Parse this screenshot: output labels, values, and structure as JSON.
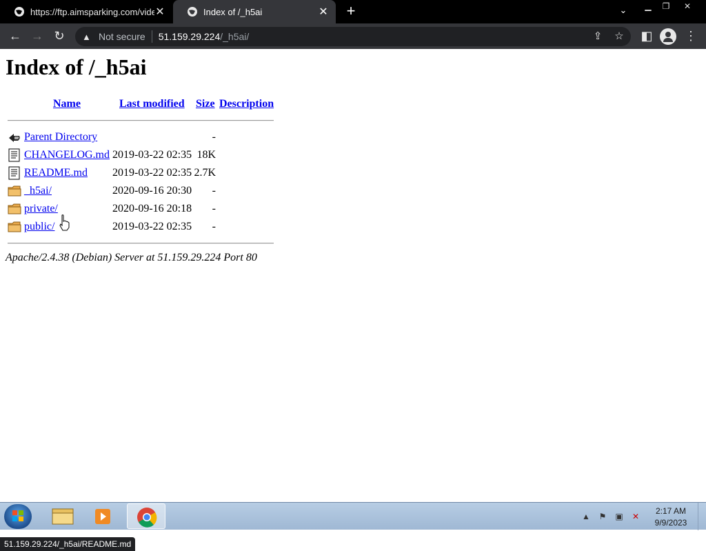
{
  "browser": {
    "tabs": [
      {
        "title": "https://ftp.aimsparking.com/vide",
        "active": false
      },
      {
        "title": "Index of /_h5ai",
        "active": true
      }
    ],
    "new_tab_label": "+",
    "omnibox": {
      "security_label": "Not secure",
      "host": "51.159.29.224",
      "path": "/_h5ai/"
    },
    "status_url": "51.159.29.224/_h5ai/README.md"
  },
  "page": {
    "title": "Index of /_h5ai",
    "columns": {
      "name": "Name",
      "last_modified": "Last modified",
      "size": "Size",
      "description": "Description"
    },
    "rows": [
      {
        "icon": "back-icon",
        "name": "Parent Directory",
        "modified": "",
        "size": "-"
      },
      {
        "icon": "text-file-icon",
        "name": "CHANGELOG.md",
        "modified": "2019-03-22 02:35",
        "size": "18K"
      },
      {
        "icon": "text-file-icon",
        "name": "README.md",
        "modified": "2019-03-22 02:35",
        "size": "2.7K"
      },
      {
        "icon": "folder-icon",
        "name": "_h5ai/",
        "modified": "2020-09-16 20:30",
        "size": "-"
      },
      {
        "icon": "folder-icon",
        "name": "private/",
        "modified": "2020-09-16 20:18",
        "size": "-"
      },
      {
        "icon": "folder-icon",
        "name": "public/",
        "modified": "2019-03-22 02:35",
        "size": "-"
      }
    ],
    "server_signature": "Apache/2.4.38 (Debian) Server at 51.159.29.224 Port 80"
  },
  "taskbar": {
    "clock_time": "2:17 AM",
    "clock_date": "9/9/2023"
  },
  "colors": {
    "link": "#0000ee",
    "tab_active": "#35363a",
    "toolbar": "#35363a"
  }
}
